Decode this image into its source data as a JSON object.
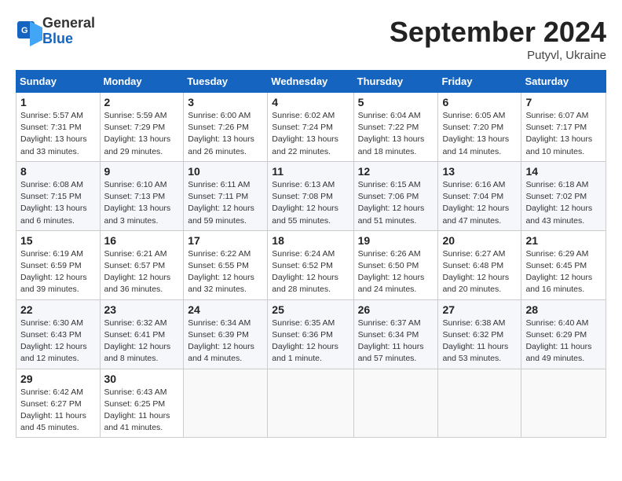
{
  "header": {
    "logo_general": "General",
    "logo_blue": "Blue",
    "month_title": "September 2024",
    "location": "Putyvl, Ukraine"
  },
  "weekdays": [
    "Sunday",
    "Monday",
    "Tuesday",
    "Wednesday",
    "Thursday",
    "Friday",
    "Saturday"
  ],
  "weeks": [
    [
      {
        "day": "1",
        "info": "Sunrise: 5:57 AM\nSunset: 7:31 PM\nDaylight: 13 hours\nand 33 minutes."
      },
      {
        "day": "2",
        "info": "Sunrise: 5:59 AM\nSunset: 7:29 PM\nDaylight: 13 hours\nand 29 minutes."
      },
      {
        "day": "3",
        "info": "Sunrise: 6:00 AM\nSunset: 7:26 PM\nDaylight: 13 hours\nand 26 minutes."
      },
      {
        "day": "4",
        "info": "Sunrise: 6:02 AM\nSunset: 7:24 PM\nDaylight: 13 hours\nand 22 minutes."
      },
      {
        "day": "5",
        "info": "Sunrise: 6:04 AM\nSunset: 7:22 PM\nDaylight: 13 hours\nand 18 minutes."
      },
      {
        "day": "6",
        "info": "Sunrise: 6:05 AM\nSunset: 7:20 PM\nDaylight: 13 hours\nand 14 minutes."
      },
      {
        "day": "7",
        "info": "Sunrise: 6:07 AM\nSunset: 7:17 PM\nDaylight: 13 hours\nand 10 minutes."
      }
    ],
    [
      {
        "day": "8",
        "info": "Sunrise: 6:08 AM\nSunset: 7:15 PM\nDaylight: 13 hours\nand 6 minutes."
      },
      {
        "day": "9",
        "info": "Sunrise: 6:10 AM\nSunset: 7:13 PM\nDaylight: 13 hours\nand 3 minutes."
      },
      {
        "day": "10",
        "info": "Sunrise: 6:11 AM\nSunset: 7:11 PM\nDaylight: 12 hours\nand 59 minutes."
      },
      {
        "day": "11",
        "info": "Sunrise: 6:13 AM\nSunset: 7:08 PM\nDaylight: 12 hours\nand 55 minutes."
      },
      {
        "day": "12",
        "info": "Sunrise: 6:15 AM\nSunset: 7:06 PM\nDaylight: 12 hours\nand 51 minutes."
      },
      {
        "day": "13",
        "info": "Sunrise: 6:16 AM\nSunset: 7:04 PM\nDaylight: 12 hours\nand 47 minutes."
      },
      {
        "day": "14",
        "info": "Sunrise: 6:18 AM\nSunset: 7:02 PM\nDaylight: 12 hours\nand 43 minutes."
      }
    ],
    [
      {
        "day": "15",
        "info": "Sunrise: 6:19 AM\nSunset: 6:59 PM\nDaylight: 12 hours\nand 39 minutes."
      },
      {
        "day": "16",
        "info": "Sunrise: 6:21 AM\nSunset: 6:57 PM\nDaylight: 12 hours\nand 36 minutes."
      },
      {
        "day": "17",
        "info": "Sunrise: 6:22 AM\nSunset: 6:55 PM\nDaylight: 12 hours\nand 32 minutes."
      },
      {
        "day": "18",
        "info": "Sunrise: 6:24 AM\nSunset: 6:52 PM\nDaylight: 12 hours\nand 28 minutes."
      },
      {
        "day": "19",
        "info": "Sunrise: 6:26 AM\nSunset: 6:50 PM\nDaylight: 12 hours\nand 24 minutes."
      },
      {
        "day": "20",
        "info": "Sunrise: 6:27 AM\nSunset: 6:48 PM\nDaylight: 12 hours\nand 20 minutes."
      },
      {
        "day": "21",
        "info": "Sunrise: 6:29 AM\nSunset: 6:45 PM\nDaylight: 12 hours\nand 16 minutes."
      }
    ],
    [
      {
        "day": "22",
        "info": "Sunrise: 6:30 AM\nSunset: 6:43 PM\nDaylight: 12 hours\nand 12 minutes."
      },
      {
        "day": "23",
        "info": "Sunrise: 6:32 AM\nSunset: 6:41 PM\nDaylight: 12 hours\nand 8 minutes."
      },
      {
        "day": "24",
        "info": "Sunrise: 6:34 AM\nSunset: 6:39 PM\nDaylight: 12 hours\nand 4 minutes."
      },
      {
        "day": "25",
        "info": "Sunrise: 6:35 AM\nSunset: 6:36 PM\nDaylight: 12 hours\nand 1 minute."
      },
      {
        "day": "26",
        "info": "Sunrise: 6:37 AM\nSunset: 6:34 PM\nDaylight: 11 hours\nand 57 minutes."
      },
      {
        "day": "27",
        "info": "Sunrise: 6:38 AM\nSunset: 6:32 PM\nDaylight: 11 hours\nand 53 minutes."
      },
      {
        "day": "28",
        "info": "Sunrise: 6:40 AM\nSunset: 6:29 PM\nDaylight: 11 hours\nand 49 minutes."
      }
    ],
    [
      {
        "day": "29",
        "info": "Sunrise: 6:42 AM\nSunset: 6:27 PM\nDaylight: 11 hours\nand 45 minutes."
      },
      {
        "day": "30",
        "info": "Sunrise: 6:43 AM\nSunset: 6:25 PM\nDaylight: 11 hours\nand 41 minutes."
      },
      {
        "day": "",
        "info": ""
      },
      {
        "day": "",
        "info": ""
      },
      {
        "day": "",
        "info": ""
      },
      {
        "day": "",
        "info": ""
      },
      {
        "day": "",
        "info": ""
      }
    ]
  ]
}
